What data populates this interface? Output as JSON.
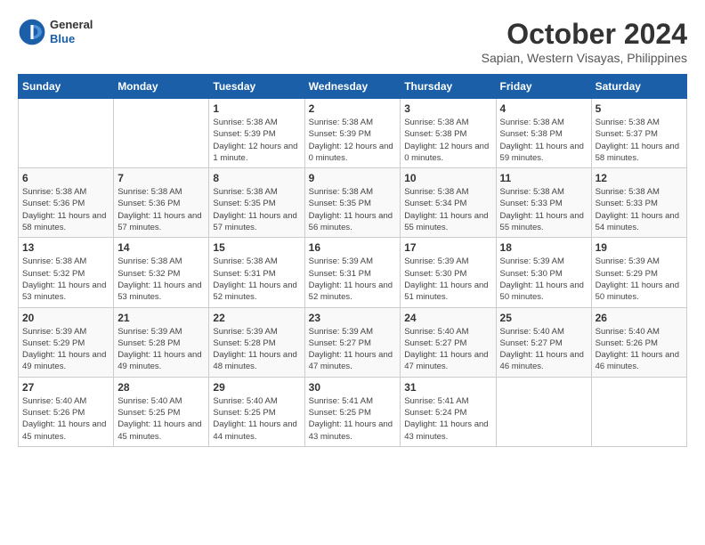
{
  "logo": {
    "general": "General",
    "blue": "Blue"
  },
  "header": {
    "month": "October 2024",
    "location": "Sapian, Western Visayas, Philippines"
  },
  "weekdays": [
    "Sunday",
    "Monday",
    "Tuesday",
    "Wednesday",
    "Thursday",
    "Friday",
    "Saturday"
  ],
  "weeks": [
    [
      null,
      null,
      {
        "day": 1,
        "sunrise": "5:38 AM",
        "sunset": "5:39 PM",
        "daylight": "12 hours and 1 minute."
      },
      {
        "day": 2,
        "sunrise": "5:38 AM",
        "sunset": "5:39 PM",
        "daylight": "12 hours and 0 minutes."
      },
      {
        "day": 3,
        "sunrise": "5:38 AM",
        "sunset": "5:38 PM",
        "daylight": "12 hours and 0 minutes."
      },
      {
        "day": 4,
        "sunrise": "5:38 AM",
        "sunset": "5:38 PM",
        "daylight": "11 hours and 59 minutes."
      },
      {
        "day": 5,
        "sunrise": "5:38 AM",
        "sunset": "5:37 PM",
        "daylight": "11 hours and 58 minutes."
      }
    ],
    [
      {
        "day": 6,
        "sunrise": "5:38 AM",
        "sunset": "5:36 PM",
        "daylight": "11 hours and 58 minutes."
      },
      {
        "day": 7,
        "sunrise": "5:38 AM",
        "sunset": "5:36 PM",
        "daylight": "11 hours and 57 minutes."
      },
      {
        "day": 8,
        "sunrise": "5:38 AM",
        "sunset": "5:35 PM",
        "daylight": "11 hours and 57 minutes."
      },
      {
        "day": 9,
        "sunrise": "5:38 AM",
        "sunset": "5:35 PM",
        "daylight": "11 hours and 56 minutes."
      },
      {
        "day": 10,
        "sunrise": "5:38 AM",
        "sunset": "5:34 PM",
        "daylight": "11 hours and 55 minutes."
      },
      {
        "day": 11,
        "sunrise": "5:38 AM",
        "sunset": "5:33 PM",
        "daylight": "11 hours and 55 minutes."
      },
      {
        "day": 12,
        "sunrise": "5:38 AM",
        "sunset": "5:33 PM",
        "daylight": "11 hours and 54 minutes."
      }
    ],
    [
      {
        "day": 13,
        "sunrise": "5:38 AM",
        "sunset": "5:32 PM",
        "daylight": "11 hours and 53 minutes."
      },
      {
        "day": 14,
        "sunrise": "5:38 AM",
        "sunset": "5:32 PM",
        "daylight": "11 hours and 53 minutes."
      },
      {
        "day": 15,
        "sunrise": "5:38 AM",
        "sunset": "5:31 PM",
        "daylight": "11 hours and 52 minutes."
      },
      {
        "day": 16,
        "sunrise": "5:39 AM",
        "sunset": "5:31 PM",
        "daylight": "11 hours and 52 minutes."
      },
      {
        "day": 17,
        "sunrise": "5:39 AM",
        "sunset": "5:30 PM",
        "daylight": "11 hours and 51 minutes."
      },
      {
        "day": 18,
        "sunrise": "5:39 AM",
        "sunset": "5:30 PM",
        "daylight": "11 hours and 50 minutes."
      },
      {
        "day": 19,
        "sunrise": "5:39 AM",
        "sunset": "5:29 PM",
        "daylight": "11 hours and 50 minutes."
      }
    ],
    [
      {
        "day": 20,
        "sunrise": "5:39 AM",
        "sunset": "5:29 PM",
        "daylight": "11 hours and 49 minutes."
      },
      {
        "day": 21,
        "sunrise": "5:39 AM",
        "sunset": "5:28 PM",
        "daylight": "11 hours and 49 minutes."
      },
      {
        "day": 22,
        "sunrise": "5:39 AM",
        "sunset": "5:28 PM",
        "daylight": "11 hours and 48 minutes."
      },
      {
        "day": 23,
        "sunrise": "5:39 AM",
        "sunset": "5:27 PM",
        "daylight": "11 hours and 47 minutes."
      },
      {
        "day": 24,
        "sunrise": "5:40 AM",
        "sunset": "5:27 PM",
        "daylight": "11 hours and 47 minutes."
      },
      {
        "day": 25,
        "sunrise": "5:40 AM",
        "sunset": "5:27 PM",
        "daylight": "11 hours and 46 minutes."
      },
      {
        "day": 26,
        "sunrise": "5:40 AM",
        "sunset": "5:26 PM",
        "daylight": "11 hours and 46 minutes."
      }
    ],
    [
      {
        "day": 27,
        "sunrise": "5:40 AM",
        "sunset": "5:26 PM",
        "daylight": "11 hours and 45 minutes."
      },
      {
        "day": 28,
        "sunrise": "5:40 AM",
        "sunset": "5:25 PM",
        "daylight": "11 hours and 45 minutes."
      },
      {
        "day": 29,
        "sunrise": "5:40 AM",
        "sunset": "5:25 PM",
        "daylight": "11 hours and 44 minutes."
      },
      {
        "day": 30,
        "sunrise": "5:41 AM",
        "sunset": "5:25 PM",
        "daylight": "11 hours and 43 minutes."
      },
      {
        "day": 31,
        "sunrise": "5:41 AM",
        "sunset": "5:24 PM",
        "daylight": "11 hours and 43 minutes."
      },
      null,
      null
    ]
  ]
}
